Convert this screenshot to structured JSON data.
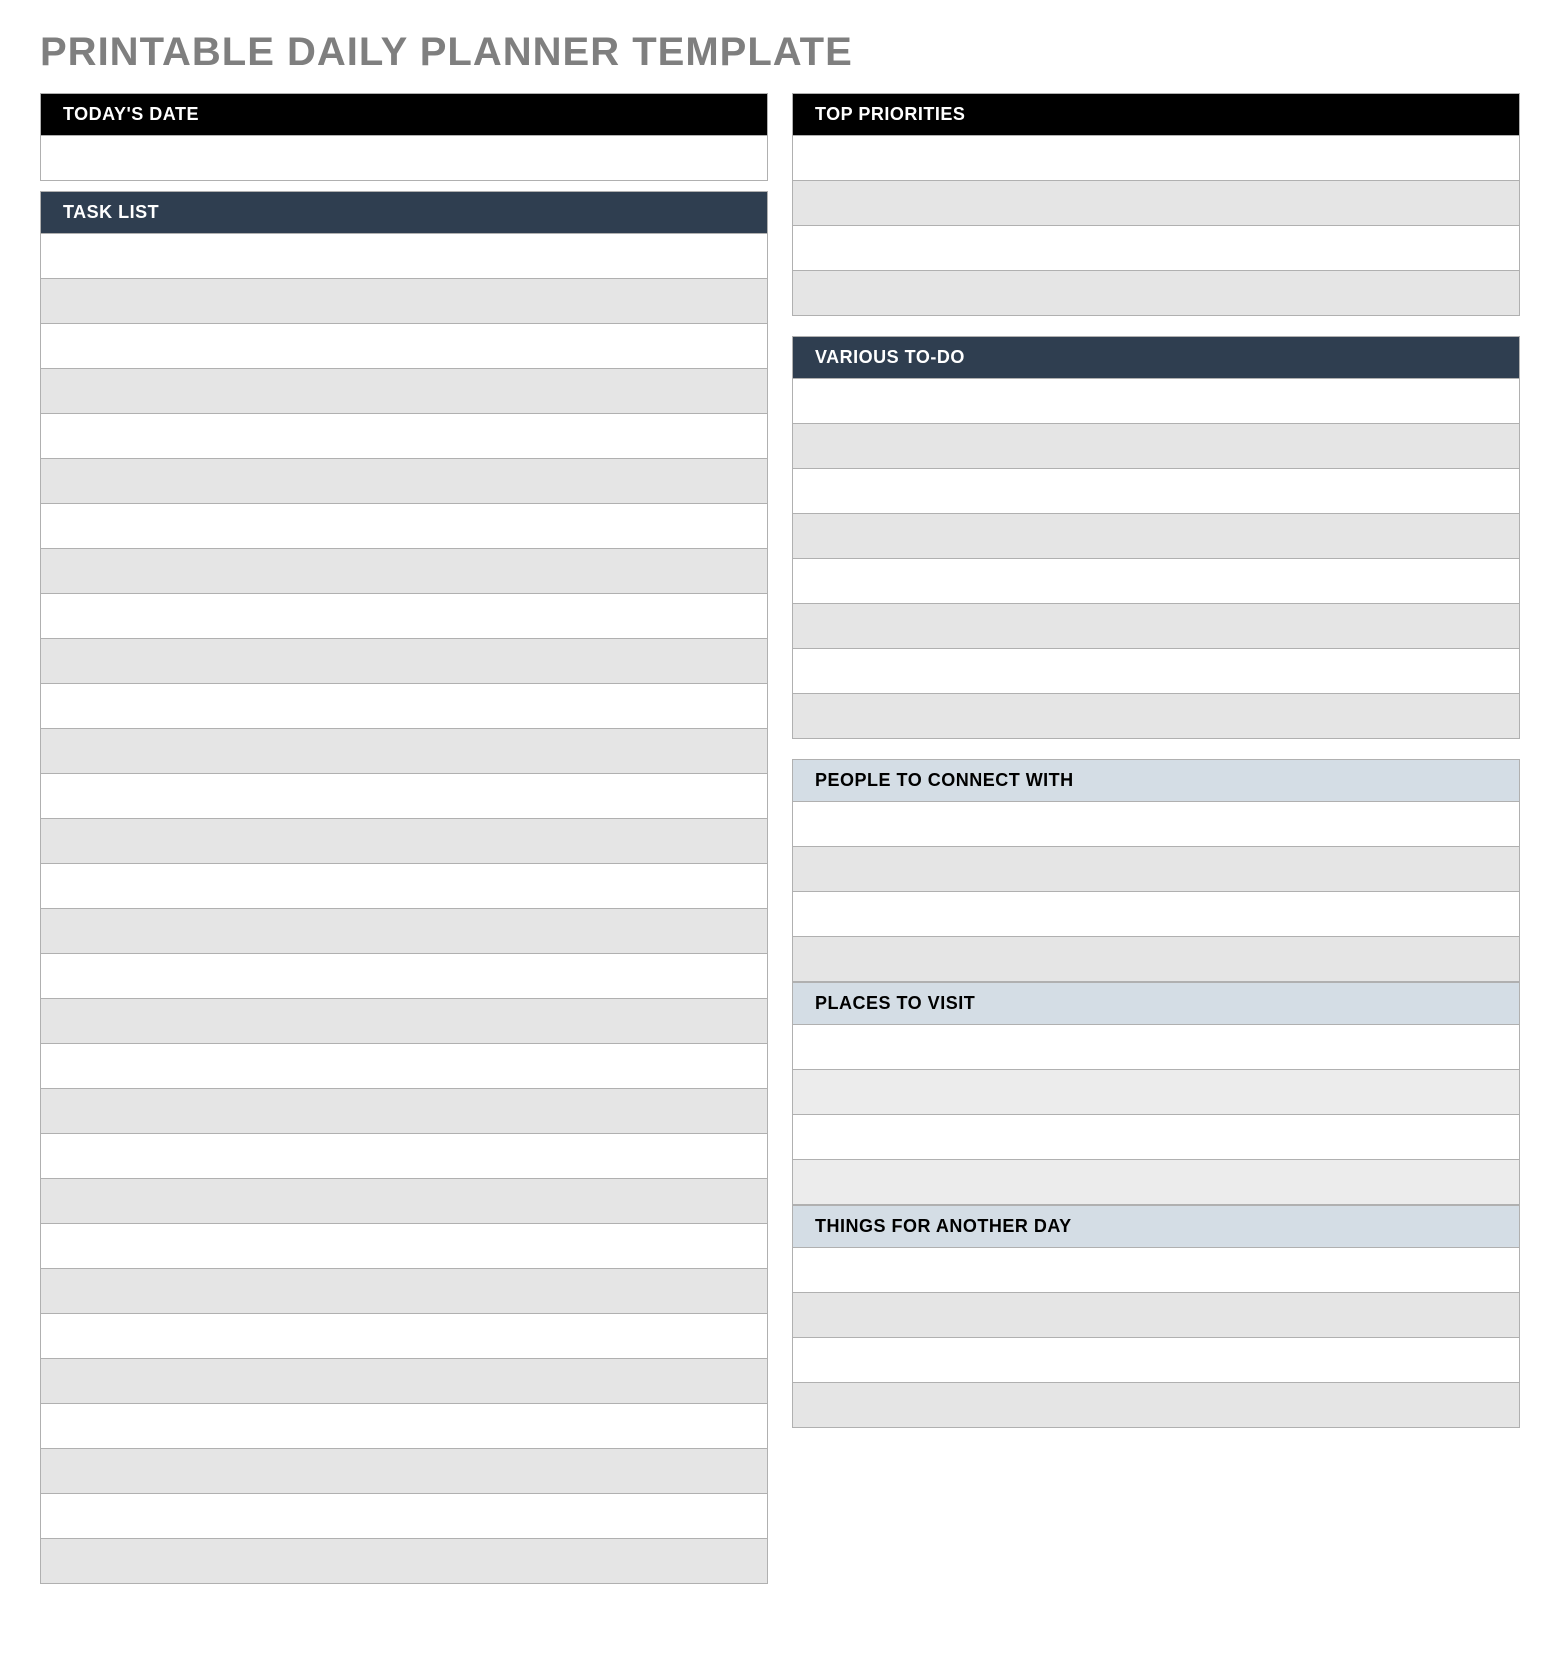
{
  "title": "PRINTABLE DAILY PLANNER TEMPLATE",
  "left": {
    "date_header": "TODAY'S DATE",
    "task_header": "TASK LIST"
  },
  "right": {
    "priorities_header": "TOP PRIORITIES",
    "todo_header": "VARIOUS TO-DO",
    "people_header": "PEOPLE TO CONNECT WITH",
    "places_header": "PLACES TO VISIT",
    "things_header": "THINGS FOR ANOTHER DAY"
  },
  "colors": {
    "title": "#7f7f7f",
    "black": "#000000",
    "navy": "#2f3e50",
    "blue": "#d4dde5",
    "gray": "#e5e5e5",
    "lightgray": "#ececec",
    "border": "#b0b0b0"
  }
}
